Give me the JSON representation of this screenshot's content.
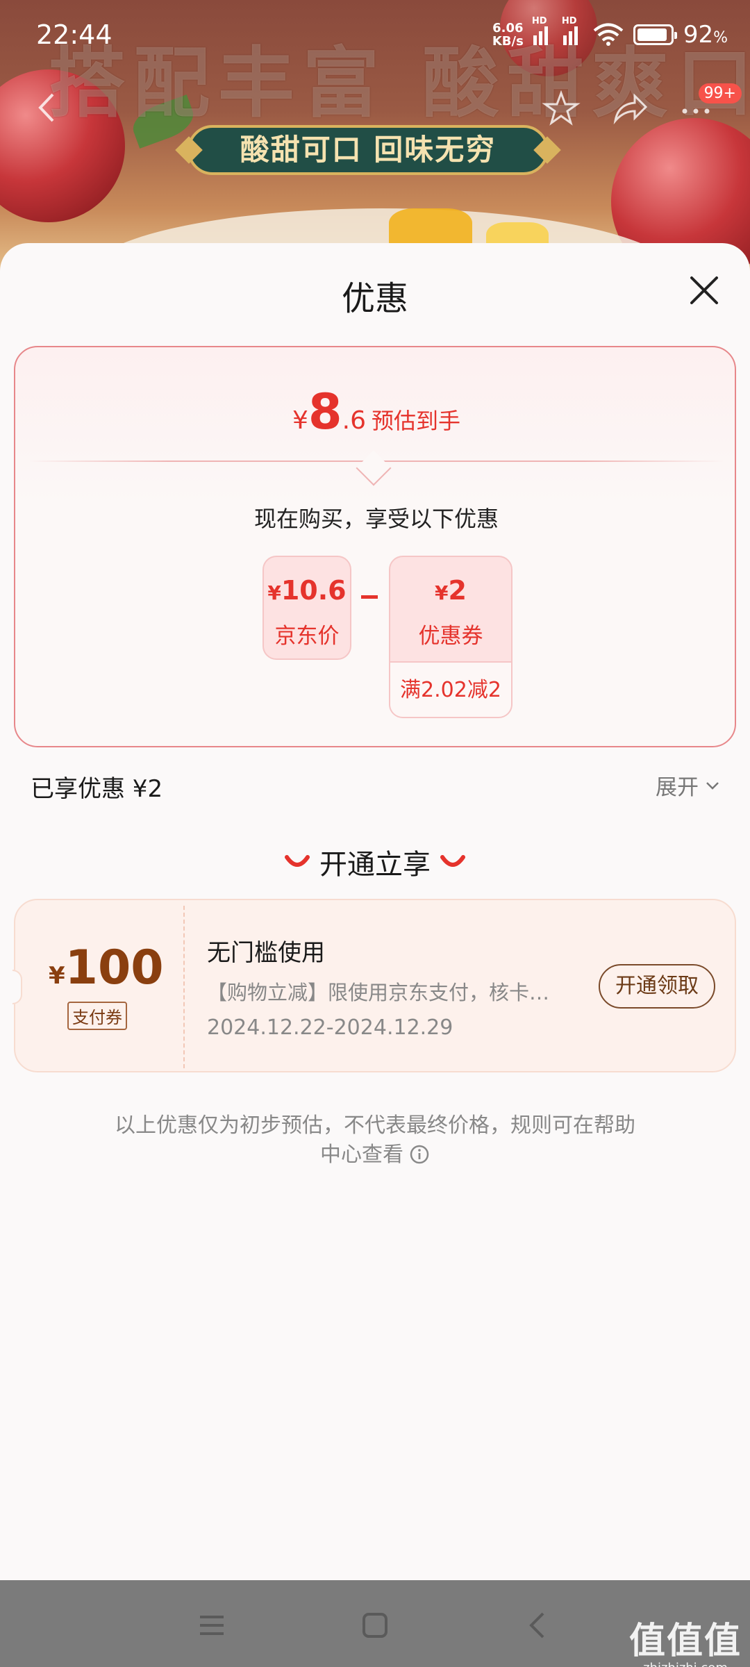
{
  "status": {
    "time": "22:44",
    "net_speed_value": "6.06",
    "net_speed_unit": "KB/s",
    "hd_label": "HD",
    "battery_percent": "92",
    "battery_unit": "%",
    "battery_level": 0.92
  },
  "banner": {
    "headline": "搭配丰富 酸甜爽口",
    "subtitle": "酸甜可口 回味无穷",
    "badge": "99+"
  },
  "sheet": {
    "title": "优惠",
    "summary": {
      "currency": "¥",
      "final_int": "8",
      "final_dec": ".6",
      "final_tag": "预估到手",
      "enjoy_text": "现在购买，享受以下优惠",
      "jd_price_num": "10.6",
      "jd_price_label": "京东价",
      "coupon_num": "2",
      "coupon_label": "优惠券",
      "coupon_rule": "满2.02减2"
    },
    "enjoyed": "已享优惠 ¥2",
    "expand_label": "展开",
    "open_section_title": "开通立享",
    "ticket": {
      "currency": "¥",
      "amount": "100",
      "type": "支付券",
      "condition": "无门槛使用",
      "description": "【购物立减】限使用京东支付，核卡…",
      "date_range": "2024.12.22-2024.12.29",
      "claim_label": "开通领取"
    },
    "disclaimer_line1": "以上优惠仅为初步预估，不代表最终价格，规则可在帮助",
    "disclaimer_line2": "中心查看"
  },
  "watermark": {
    "big": "值值值",
    "small": "zhizhizhi.com"
  },
  "colors": {
    "accent_red": "#e5332c",
    "coupon_brown": "#8a3f0f",
    "sheet_bg": "#fbf9f9"
  }
}
